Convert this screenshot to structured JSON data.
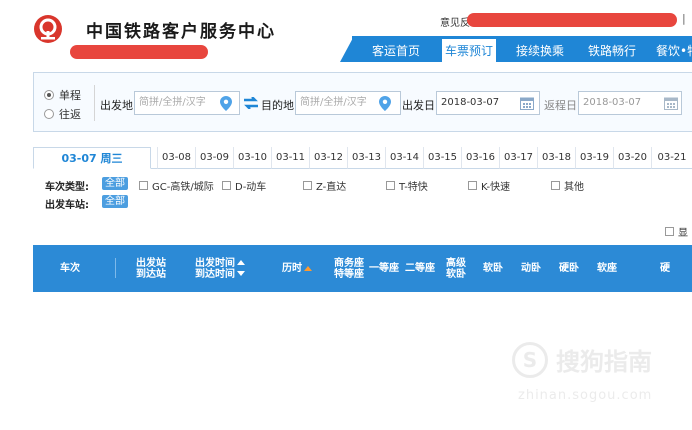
{
  "header": {
    "brand": "中国铁路客户服务中心",
    "feedback_label": "意见反",
    "separator": "|",
    "nav": [
      {
        "label": "客运首页",
        "active": false
      },
      {
        "label": "车票预订",
        "active": true
      },
      {
        "label": "接续换乘",
        "active": false
      },
      {
        "label": "铁路畅行",
        "active": false
      },
      {
        "label": "餐饮•特",
        "active": false
      }
    ],
    "colors": {
      "brand_red": "#e8463e",
      "nav_blue": "#1f86d6"
    }
  },
  "search": {
    "trip_type": [
      {
        "label": "单程",
        "checked": true
      },
      {
        "label": "往返",
        "checked": false
      }
    ],
    "from_label": "出发地",
    "from_placeholder": "简拼/全拼/汉字",
    "to_label": "目的地",
    "to_placeholder": "简拼/全拼/汉字",
    "depart_label": "出发日",
    "depart_value": "2018-03-07",
    "return_label": "返程日",
    "return_value": "2018-03-07"
  },
  "date_tabs": [
    {
      "label": "03-07 周三",
      "active": true
    },
    {
      "label": "03-08",
      "active": false
    },
    {
      "label": "03-09",
      "active": false
    },
    {
      "label": "03-10",
      "active": false
    },
    {
      "label": "03-11",
      "active": false
    },
    {
      "label": "03-12",
      "active": false
    },
    {
      "label": "03-13",
      "active": false
    },
    {
      "label": "03-14",
      "active": false
    },
    {
      "label": "03-15",
      "active": false
    },
    {
      "label": "03-16",
      "active": false
    },
    {
      "label": "03-17",
      "active": false
    },
    {
      "label": "03-18",
      "active": false
    },
    {
      "label": "03-19",
      "active": false
    },
    {
      "label": "03-20",
      "active": false
    },
    {
      "label": "03-21",
      "active": false
    }
  ],
  "filters": {
    "type_label": "车次类型:",
    "type_all": "全部",
    "types": [
      "GC-高铁/城际",
      "D-动车",
      "Z-直达",
      "T-特快",
      "K-快速",
      "其他"
    ],
    "station_label": "出发车站:",
    "station_all": "全部",
    "show_label": "显"
  },
  "table_header": {
    "train": "车次",
    "station_top": "出发站",
    "station_bottom": "到达站",
    "time_top": "出发时间",
    "time_bottom": "到达时间",
    "duration": "历时",
    "business_top": "商务座",
    "business_bottom": "特等座",
    "first": "一等座",
    "second": "二等座",
    "adv_soft_top": "高级",
    "adv_soft_bottom": "软卧",
    "soft_sleeper": "软卧",
    "moving_sleeper": "动卧",
    "hard_sleeper": "硬卧",
    "soft_seat": "软座",
    "hard_seat_cut": "硬"
  },
  "watermark": {
    "logo": "S",
    "text": "搜狗指南",
    "url": "zhinan.sogou.com"
  }
}
